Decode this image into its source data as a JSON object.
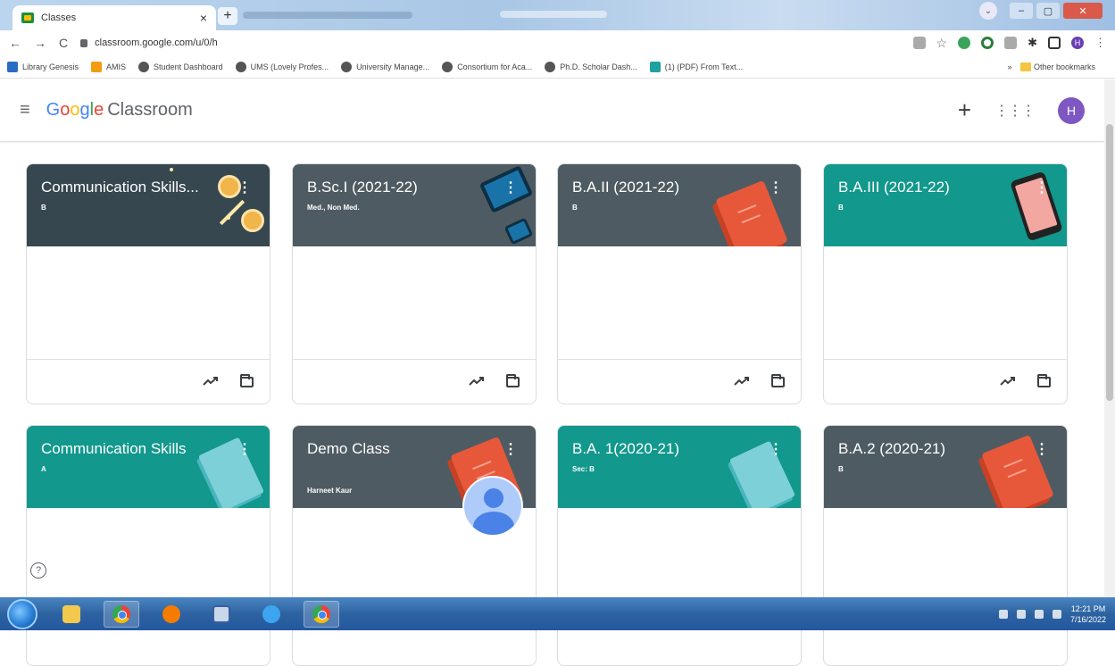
{
  "browser": {
    "tab_title": "Classes",
    "tab_close": "×",
    "new_tab": "+",
    "url": "classroom.google.com/u/0/h",
    "nav": {
      "back": "←",
      "forward": "→",
      "reload": "C"
    },
    "bookmarks": [
      "Library Genesis",
      "AMIS",
      "Student Dashboard",
      "UMS (Lovely Profes...",
      "University Manage...",
      "Consortium for Aca...",
      "Ph.D. Scholar Dash...",
      "(1) (PDF) From Text..."
    ],
    "other_bookmarks": "Other bookmarks",
    "bookmarks_overflow": "»",
    "profile_initial": "H"
  },
  "app": {
    "logo": {
      "google": [
        "G",
        "o",
        "o",
        "g",
        "l",
        "e"
      ],
      "product": "Classroom"
    },
    "menu_icon": "≡",
    "add_icon": "+",
    "apps_icon": "⋮⋮⋮",
    "avatar_initial": "H",
    "help_icon": "?"
  },
  "classes": [
    {
      "title": "Communication Skills...",
      "section": "B",
      "teacher": "",
      "theme": "dark"
    },
    {
      "title": "B.Sc.I (2021-22)",
      "section": "Med., Non Med.",
      "teacher": "",
      "theme": "gray"
    },
    {
      "title": "B.A.II (2021-22)",
      "section": "B",
      "teacher": "",
      "theme": "gray"
    },
    {
      "title": "B.A.III (2021-22)",
      "section": "B",
      "teacher": "",
      "theme": "teal"
    },
    {
      "title": "Communication Skills",
      "section": "A",
      "teacher": "",
      "theme": "teal"
    },
    {
      "title": "Demo Class",
      "section": "",
      "teacher": "Harneet Kaur",
      "theme": "gray"
    },
    {
      "title": "B.A. 1(2020-21)",
      "section": "Sec: B",
      "teacher": "",
      "theme": "teal"
    },
    {
      "title": "B.A.2 (2020-21)",
      "section": "B",
      "teacher": "",
      "theme": "gray"
    }
  ],
  "card_menu_icon": "⋮",
  "taskbar": {
    "time": "12:21 PM",
    "date": "7/16/2022"
  },
  "colors": {
    "dark": "#37474f",
    "gray": "#4f5b62",
    "teal": "#12988c",
    "avatar": "#7e57c2"
  }
}
